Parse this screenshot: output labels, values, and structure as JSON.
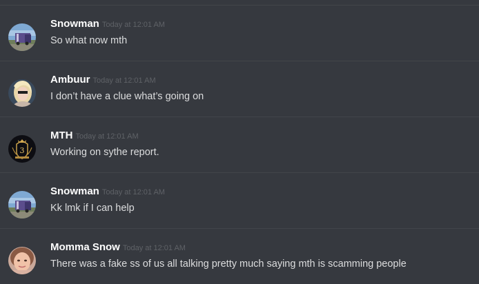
{
  "messages": [
    {
      "username": "Snowman",
      "timestamp": "Today at 12:01 AM",
      "text": "So what now mth",
      "avatar_icon": "truck-photo-avatar"
    },
    {
      "username": "Ambuur",
      "timestamp": "Today at 12:01 AM",
      "text": "I don’t have a clue what’s going on",
      "avatar_icon": "blonde-woman-photo-avatar"
    },
    {
      "username": "MTH",
      "timestamp": "Today at 12:01 AM",
      "text": "Working on sythe report.",
      "avatar_icon": "gold-crest-logo-avatar"
    },
    {
      "username": "Snowman",
      "timestamp": "Today at 12:01 AM",
      "text": "Kk lmk if I can help",
      "avatar_icon": "truck-photo-avatar"
    },
    {
      "username": "Momma Snow",
      "timestamp": "Today at 12:01 AM",
      "text": "There was a fake ss of us all talking pretty much saying mth is scamming people",
      "avatar_icon": "woman-face-photo-avatar"
    }
  ],
  "colors": {
    "background": "#36393f",
    "divider": "#42454a",
    "username": "#ffffff",
    "timestamp": "#5f6267",
    "message_text": "#dcddde"
  }
}
